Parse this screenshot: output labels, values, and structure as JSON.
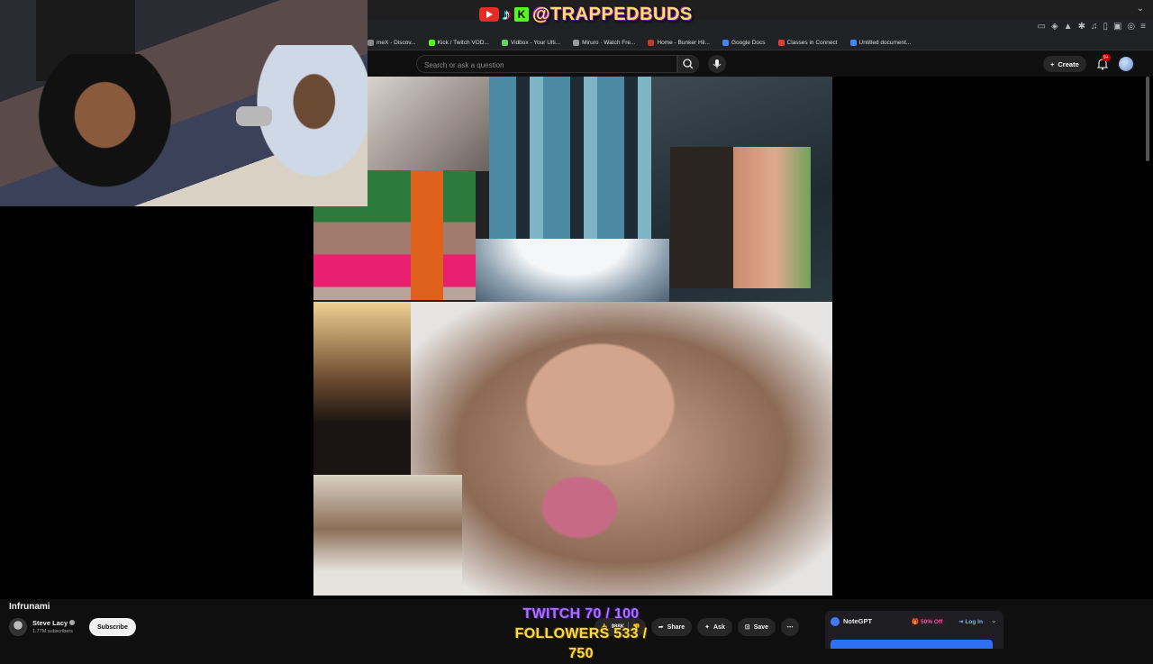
{
  "overlay": {
    "handle": "@TRAPPEDBUDS",
    "kick_letter": "K"
  },
  "bookmarks": [
    {
      "label": "meX - Discov...",
      "color": "#888888"
    },
    {
      "label": "Kick / Twitch VOD...",
      "color": "#53fc18"
    },
    {
      "label": "Vidbox - Your Ulti...",
      "color": "#5fd35f"
    },
    {
      "label": "Miruro · Watch Fre...",
      "color": "#9a9a9a"
    },
    {
      "label": "Home - Bunker Hil...",
      "color": "#c0392b"
    },
    {
      "label": "Google Docs",
      "color": "#4285f4"
    },
    {
      "label": "Classes in Connect",
      "color": "#e53935"
    },
    {
      "label": "Untitled document...",
      "color": "#4285f4"
    }
  ],
  "header": {
    "search_placeholder": "Search or ask a question",
    "create_label": "Create",
    "notifications_badge": "9+"
  },
  "video": {
    "title": "Infrunami",
    "channel": "Steve Lacy",
    "subscribers": "1.77M subscribers",
    "subscribe_label": "Subscribe",
    "like_count": "988K",
    "share_label": "Share",
    "ask_label": "Ask",
    "save_label": "Save"
  },
  "goals": {
    "twitch": "TWITCH 70 / 100",
    "followers": "FOLLOWERS 533 / 750"
  },
  "notegpt": {
    "name": "NoteGPT",
    "offer": "50% Off",
    "login": "Log In"
  },
  "colors": {
    "yt_red": "#e52d27",
    "accent_blue": "#3d7cff",
    "kick_green": "#53fc18",
    "twitch_purple": "#a970ff"
  }
}
